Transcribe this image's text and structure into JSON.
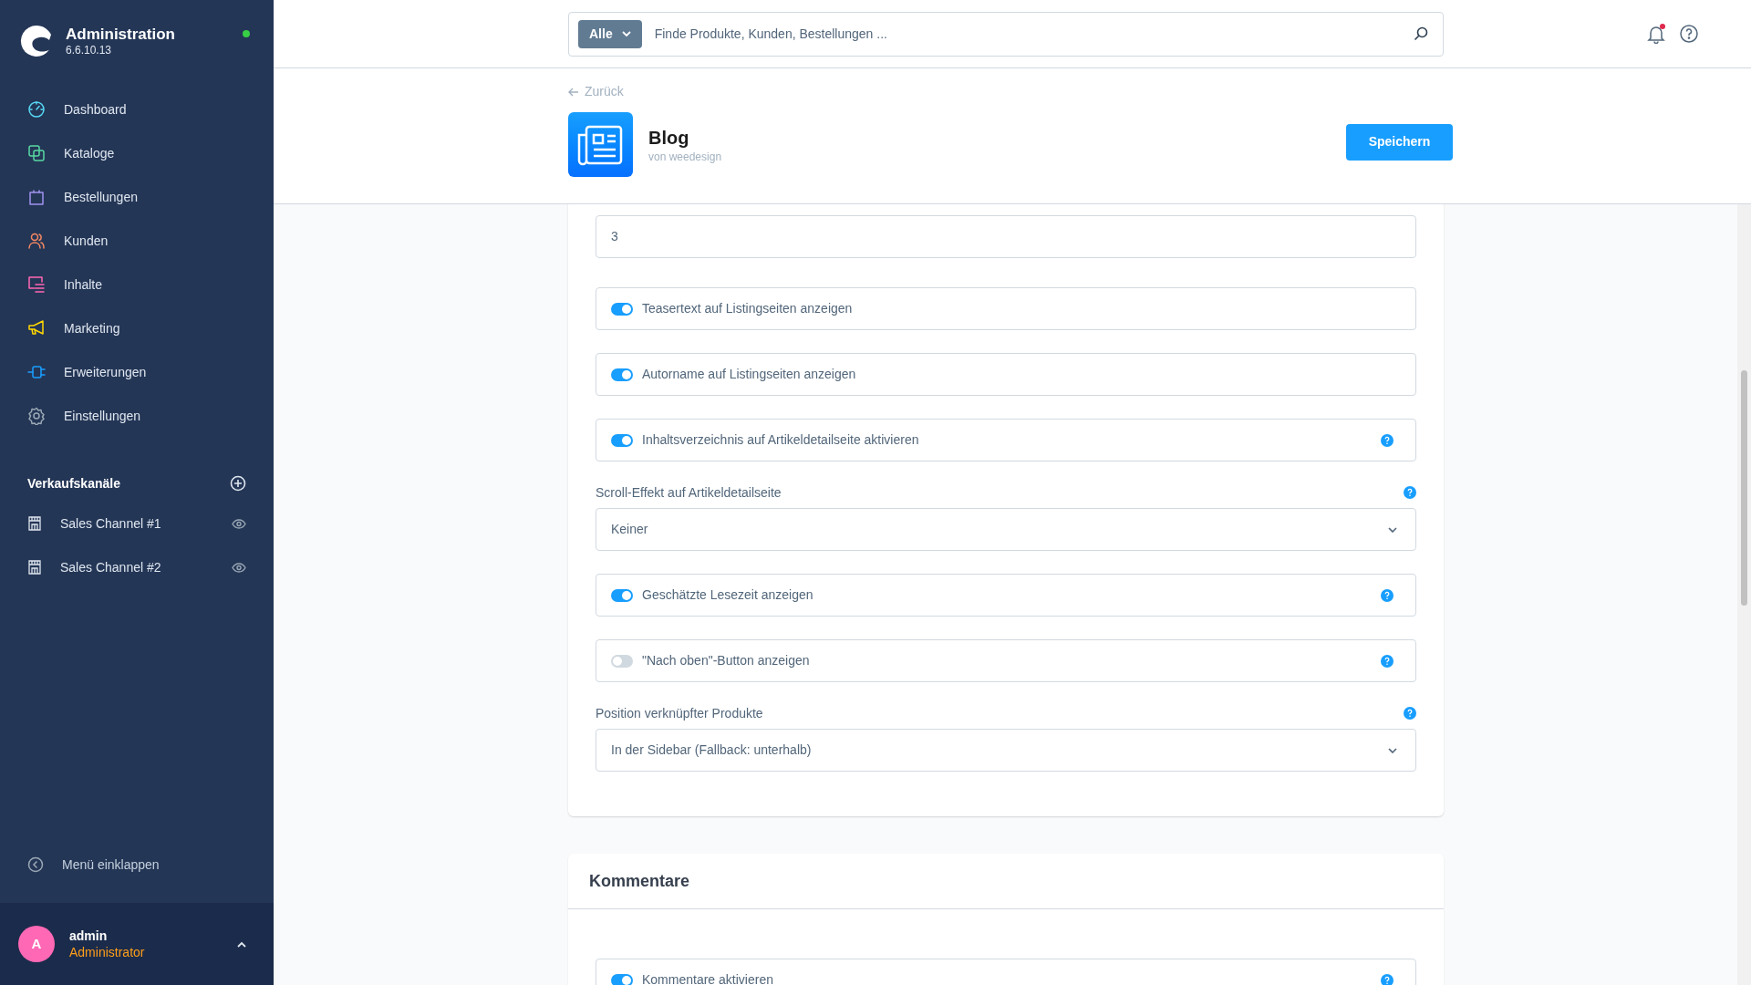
{
  "sidebar": {
    "brand": {
      "title": "Administration",
      "version": "6.6.10.13",
      "online": true
    },
    "nav": [
      {
        "label": "Dashboard"
      },
      {
        "label": "Kataloge"
      },
      {
        "label": "Bestellungen"
      },
      {
        "label": "Kunden"
      },
      {
        "label": "Inhalte"
      },
      {
        "label": "Marketing"
      },
      {
        "label": "Erweiterungen"
      },
      {
        "label": "Einstellungen"
      }
    ],
    "sales_channels": {
      "title": "Verkaufskanäle",
      "items": [
        {
          "label": "Sales Channel #1"
        },
        {
          "label": "Sales Channel #2"
        }
      ]
    },
    "collapse": "Menü einklappen",
    "user": {
      "initial": "A",
      "name": "admin",
      "role": "Administrator"
    }
  },
  "search": {
    "scope": "Alle",
    "placeholder": "Finde Produkte, Kunden, Bestellungen ..."
  },
  "notifications": {
    "unread": true
  },
  "page": {
    "back": "Zurück",
    "title": "Blog",
    "vendor": "von weedesign",
    "save": "Speichern"
  },
  "settings": [
    {
      "kind": "input",
      "value": "3"
    },
    {
      "kind": "toggle",
      "label": "Teasertext auf Listingseiten anzeigen",
      "on": true,
      "help": false
    },
    {
      "kind": "toggle",
      "label": "Autorname auf Listingseiten anzeigen",
      "on": true,
      "help": false
    },
    {
      "kind": "toggle",
      "label": "Inhaltsverzeichnis auf Artikeldetailseite aktivieren",
      "on": true,
      "help": true
    },
    {
      "kind": "select",
      "label": "Scroll-Effekt auf Artikeldetailseite",
      "value": "Keiner",
      "help": true
    },
    {
      "kind": "toggle",
      "label": "Geschätzte Lesezeit anzeigen",
      "on": true,
      "help": true
    },
    {
      "kind": "toggle",
      "label": "\"Nach oben\"-Button anzeigen",
      "on": false,
      "help": true
    },
    {
      "kind": "select",
      "label": "Position verknüpfter Produkte",
      "value": "In der Sidebar (Fallback: unterhalb)",
      "help": true
    }
  ],
  "comments": {
    "title": "Kommentare",
    "settings": [
      {
        "kind": "toggle",
        "label": "Kommentare aktivieren",
        "on": true,
        "help": true
      }
    ]
  }
}
